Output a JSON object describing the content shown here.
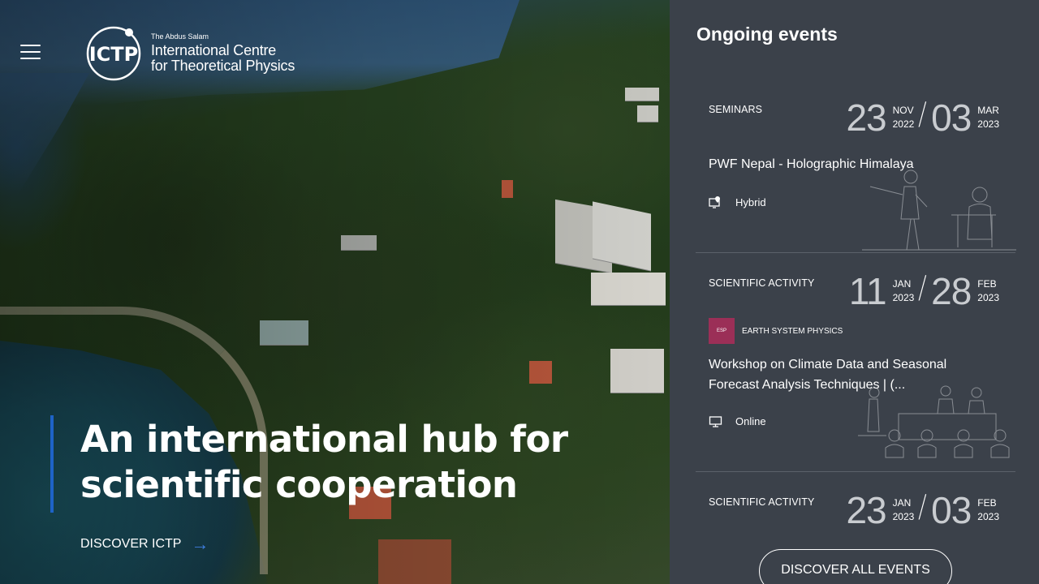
{
  "header": {
    "menu_icon": "hamburger-menu-icon",
    "logo": {
      "mark": "ICTP",
      "line_small": "The Abdus Salam",
      "line1": "International Centre",
      "line2": "for Theoretical Physics"
    }
  },
  "hero": {
    "title": "An international hub for scientific cooperation",
    "cta_label": "DISCOVER ICTP",
    "cta_icon": "arrow-right-icon",
    "accent_color": "#1e63c7"
  },
  "events_panel": {
    "title": "Ongoing events",
    "events": [
      {
        "category": "SEMINARS",
        "start_day": "23",
        "start_month": "NOV",
        "start_year": "2022",
        "end_day": "03",
        "end_month": "MAR",
        "end_year": "2023",
        "title": "PWF Nepal - Holographic Himalaya",
        "mode": "Hybrid",
        "mode_icon": "location-monitor-icon"
      },
      {
        "category": "SCIENTIFIC ACTIVITY",
        "start_day": "11",
        "start_month": "JAN",
        "start_year": "2023",
        "end_day": "28",
        "end_month": "FEB",
        "end_year": "2023",
        "tag_code": "ESP",
        "tag_name": "EARTH SYSTEM PHYSICS",
        "tag_color": "#9b2f57",
        "title": "Workshop on Climate Data and Seasonal Forecast Analysis Techniques | (...",
        "mode": "Online",
        "mode_icon": "monitor-icon"
      },
      {
        "category": "SCIENTIFIC ACTIVITY",
        "start_day": "23",
        "start_month": "JAN",
        "start_year": "2023",
        "end_day": "03",
        "end_month": "FEB",
        "end_year": "2023"
      }
    ],
    "discover_all_label": "DISCOVER ALL EVENTS",
    "background_color": "#3b414a"
  }
}
